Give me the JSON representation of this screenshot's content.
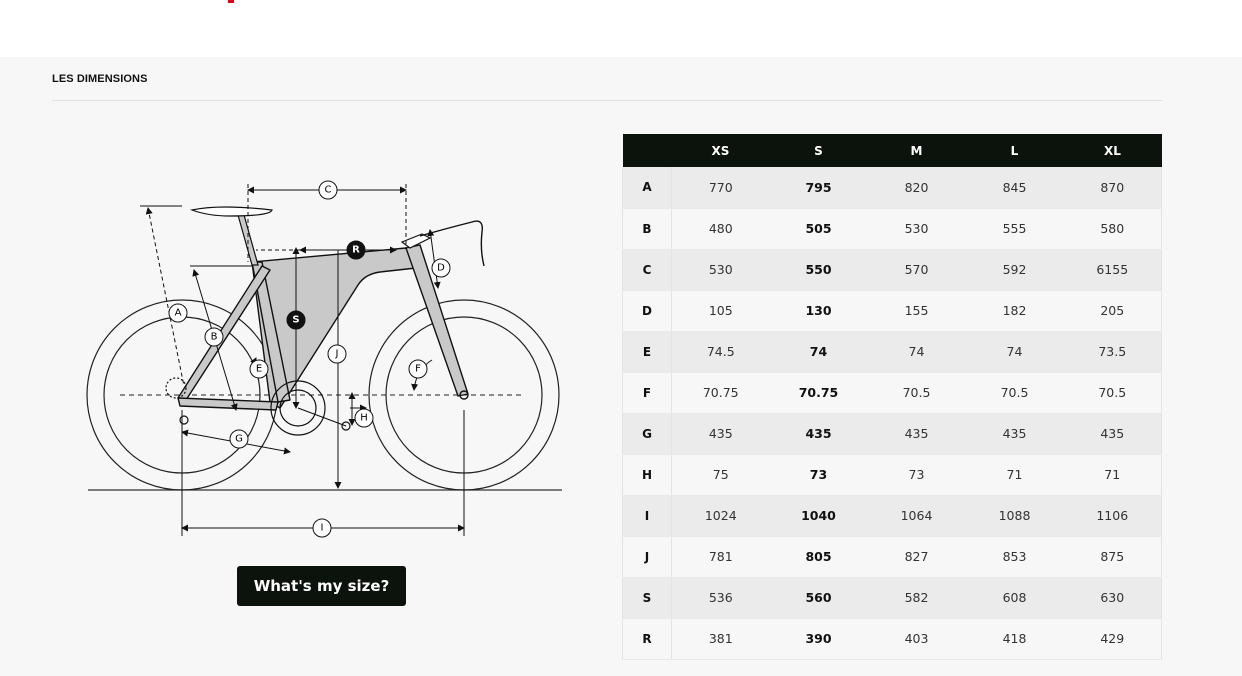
{
  "section": {
    "title": "LES DIMENSIONS"
  },
  "diagram": {
    "labels": [
      "A",
      "B",
      "C",
      "D",
      "E",
      "F",
      "G",
      "H",
      "I",
      "J"
    ],
    "dark_labels": [
      "R",
      "S"
    ]
  },
  "button": {
    "label": "What's my size?"
  },
  "table": {
    "headers": [
      "XS",
      "S",
      "M",
      "L",
      "XL"
    ],
    "rows": [
      {
        "label": "A",
        "values": [
          "770",
          "795",
          "820",
          "845",
          "870"
        ]
      },
      {
        "label": "B",
        "values": [
          "480",
          "505",
          "530",
          "555",
          "580"
        ]
      },
      {
        "label": "C",
        "values": [
          "530",
          "550",
          "570",
          "592",
          "6155"
        ]
      },
      {
        "label": "D",
        "values": [
          "105",
          "130",
          "155",
          "182",
          "205"
        ]
      },
      {
        "label": "E",
        "values": [
          "74.5",
          "74",
          "74",
          "74",
          "73.5"
        ]
      },
      {
        "label": "F",
        "values": [
          "70.75",
          "70.75",
          "70.5",
          "70.5",
          "70.5"
        ]
      },
      {
        "label": "G",
        "values": [
          "435",
          "435",
          "435",
          "435",
          "435"
        ]
      },
      {
        "label": "H",
        "values": [
          "75",
          "73",
          "73",
          "71",
          "71"
        ]
      },
      {
        "label": "I",
        "values": [
          "1024",
          "1040",
          "1064",
          "1088",
          "1106"
        ]
      },
      {
        "label": "J",
        "values": [
          "781",
          "805",
          "827",
          "853",
          "875"
        ]
      },
      {
        "label": "S",
        "values": [
          "536",
          "560",
          "582",
          "608",
          "630"
        ]
      },
      {
        "label": "R",
        "values": [
          "381",
          "390",
          "403",
          "418",
          "429"
        ]
      }
    ]
  },
  "colors": {
    "header_bg": "#0c120c",
    "accent": "#e2001a",
    "panel_bg": "#f7f7f7"
  }
}
